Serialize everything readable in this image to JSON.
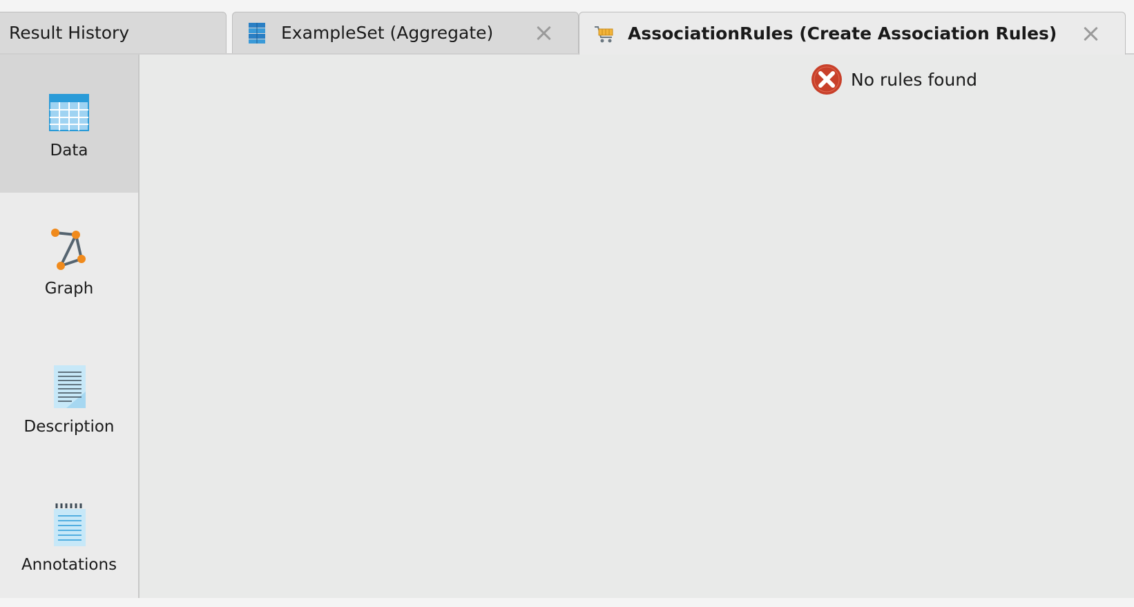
{
  "tabs": [
    {
      "label": "Result History",
      "icon": "history",
      "closable": false
    },
    {
      "label": "ExampleSet (Aggregate)",
      "icon": "table-stack-icon",
      "closable": true
    },
    {
      "label": "AssociationRules (Create Association Rules)",
      "icon": "cart-icon",
      "closable": true,
      "active": true
    }
  ],
  "sidebar": {
    "items": [
      {
        "label": "Data",
        "icon": "table-icon",
        "active": true
      },
      {
        "label": "Graph",
        "icon": "graph-icon",
        "active": false
      },
      {
        "label": "Description",
        "icon": "document-icon",
        "active": false
      },
      {
        "label": "Annotations",
        "icon": "notepad-icon",
        "active": false
      }
    ]
  },
  "main": {
    "message": "No rules found",
    "message_icon": "error-icon"
  },
  "colors": {
    "tab_bg": "#d9d9d9",
    "active_tab_bg": "#ebebeb",
    "sidebar_active": "#d6d6d6",
    "content_bg": "#e9eae9",
    "error": "#c8402a",
    "accent_blue": "#2a9bd8",
    "graph_node": "#f08a1c"
  }
}
